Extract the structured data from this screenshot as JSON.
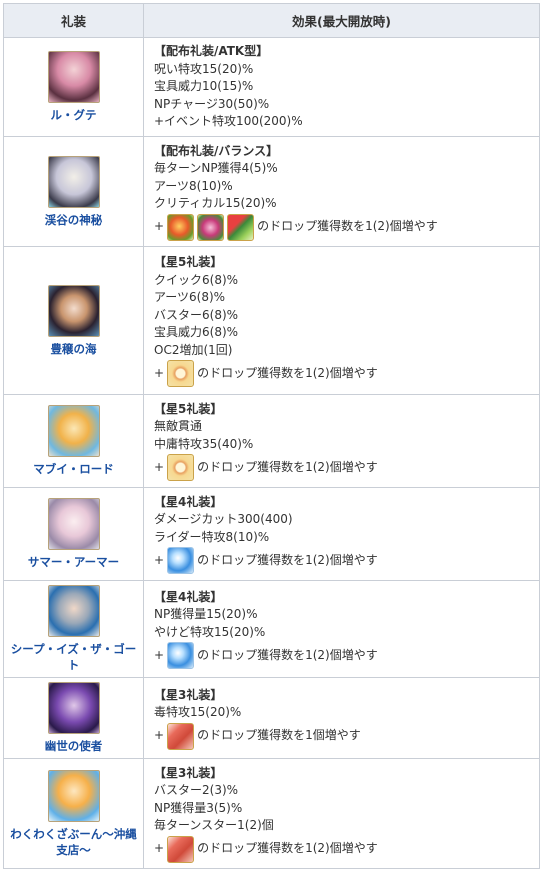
{
  "header": {
    "col_ce": "礼装",
    "col_effect": "効果(最大開放時)"
  },
  "rows": [
    {
      "name": "ル・グテ",
      "type": "【配布礼装/ATK型】",
      "effects": [
        "呪い特攻15(20)%",
        "宝具威力10(15)%",
        "NPチャージ30(50)%",
        "+イベント特攻100(200)%"
      ],
      "drop": null
    },
    {
      "name": "渓谷の神秘",
      "type": "【配布礼装/バランス】",
      "effects": [
        "毎ターンNP獲得4(5)%",
        "アーツ8(10)%",
        "クリティカル15(20)%"
      ],
      "drop": {
        "plus": "+",
        "icons": [
          "tomato-material-icon",
          "berry-material-icon",
          "vegetable-material-icon"
        ],
        "text": "のドロップ獲得数を1(2)個増やす"
      }
    },
    {
      "name": "豊穣の海",
      "type": "【星5礼装】",
      "effects": [
        "クイック6(8)%",
        "アーツ6(8)%",
        "バスター6(8)%",
        "宝具威力6(8)%",
        "OC2増加(1回)"
      ],
      "drop": {
        "plus": "+",
        "icons": [
          "ring-material-icon"
        ],
        "text": "のドロップ獲得数を1(2)個増やす"
      }
    },
    {
      "name": "マブイ・ロード",
      "type": "【星5礼装】",
      "effects": [
        "無敵貫通",
        "中庸特攻35(40)%"
      ],
      "drop": {
        "plus": "+",
        "icons": [
          "ring-material-icon"
        ],
        "text": "のドロップ獲得数を1(2)個増やす"
      }
    },
    {
      "name": "サマー・アーマー",
      "type": "【星4礼装】",
      "effects": [
        "ダメージカット300(400)",
        "ライダー特攻8(10)%"
      ],
      "drop": {
        "plus": "+",
        "icons": [
          "orb-material-icon"
        ],
        "text": "のドロップ獲得数を1(2)個増やす"
      }
    },
    {
      "name": "シープ・イズ・ザ・ゴート",
      "type": "【星4礼装】",
      "effects": [
        "NP獲得量15(20)%",
        "やけど特攻15(20)%"
      ],
      "drop": {
        "plus": "+",
        "icons": [
          "orb-material-icon"
        ],
        "text": "のドロップ獲得数を1(2)個増やす"
      }
    },
    {
      "name": "幽世の使者",
      "type": "【星3礼装】",
      "effects": [
        "毒特攻15(20)%"
      ],
      "drop": {
        "plus": "+",
        "icons": [
          "ember-material-icon"
        ],
        "text": "のドロップ獲得数を1個増やす"
      }
    },
    {
      "name": "わくわくざぶーん〜沖縄支店〜",
      "type": "【星3礼装】",
      "effects": [
        "バスター2(3)%",
        "NP獲得量3(5)%",
        "毎ターンスター1(2)個"
      ],
      "drop": {
        "plus": "+",
        "icons": [
          "ember-material-icon"
        ],
        "text": "のドロップ獲得数を1(2)個増やす"
      }
    }
  ]
}
